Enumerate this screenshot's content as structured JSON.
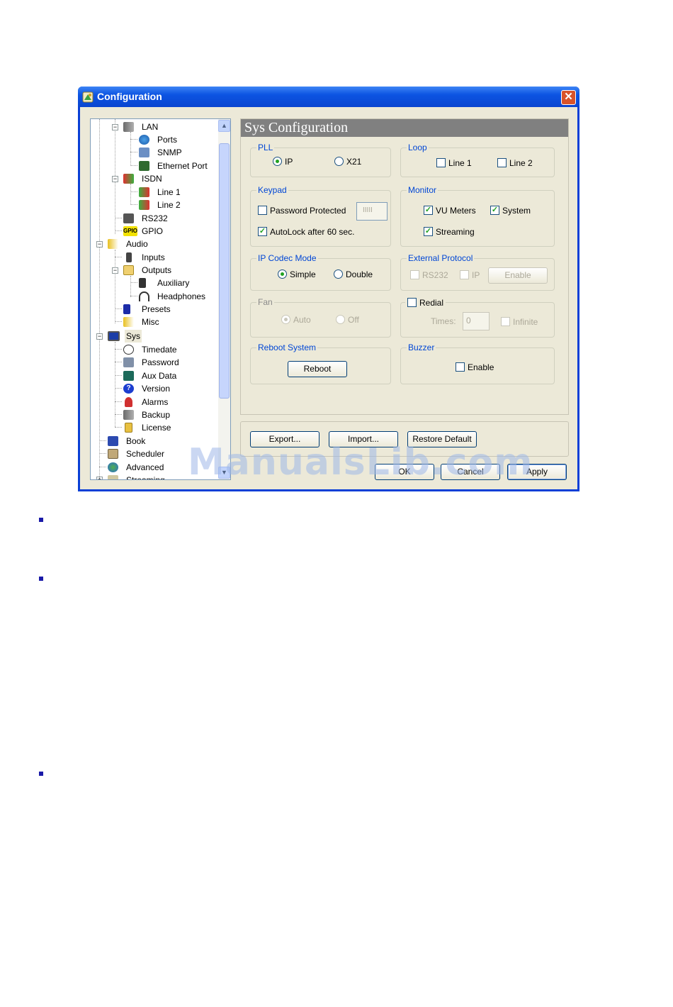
{
  "window": {
    "title": "Configuration",
    "close_label": "✕"
  },
  "tree": {
    "items": [
      {
        "label": "LAN"
      },
      {
        "label": "Ports"
      },
      {
        "label": "SNMP"
      },
      {
        "label": "Ethernet Port"
      },
      {
        "label": "ISDN"
      },
      {
        "label": "Line 1"
      },
      {
        "label": "Line 2"
      },
      {
        "label": "RS232"
      },
      {
        "label": "GPIO"
      },
      {
        "label": "Audio"
      },
      {
        "label": "Inputs"
      },
      {
        "label": "Outputs"
      },
      {
        "label": "Auxiliary"
      },
      {
        "label": "Headphones"
      },
      {
        "label": "Presets"
      },
      {
        "label": "Misc"
      },
      {
        "label": "Sys"
      },
      {
        "label": "Timedate"
      },
      {
        "label": "Password"
      },
      {
        "label": "Aux Data"
      },
      {
        "label": "Version"
      },
      {
        "label": "Alarms"
      },
      {
        "label": "Backup"
      },
      {
        "label": "License"
      },
      {
        "label": "Book"
      },
      {
        "label": "Scheduler"
      },
      {
        "label": "Advanced"
      },
      {
        "label": "Streaming"
      }
    ],
    "gpio_icon_text": "GPIO"
  },
  "panel": {
    "title": "Sys Configuration",
    "pll": {
      "title": "PLL",
      "options": [
        "IP",
        "X21"
      ],
      "selected": "IP"
    },
    "loop": {
      "title": "Loop",
      "line1": "Line 1",
      "line2": "Line 2"
    },
    "keypad": {
      "title": "Keypad",
      "password_protected": "Password Protected",
      "password_value": "IIIII",
      "autolock": "AutoLock after 60 sec."
    },
    "monitor": {
      "title": "Monitor",
      "vu_meters": "VU Meters",
      "system": "System",
      "streaming": "Streaming"
    },
    "ip_codec": {
      "title": "IP Codec Mode",
      "simple": "Simple",
      "double": "Double",
      "selected": "Simple"
    },
    "ext_protocol": {
      "title": "External Protocol",
      "rs232": "RS232",
      "ip": "IP",
      "enable_button": "Enable"
    },
    "fan": {
      "title": "Fan",
      "auto": "Auto",
      "off": "Off"
    },
    "redial": {
      "label": "Redial",
      "times_label": "Times:",
      "times_value": "0",
      "infinite": "Infinite"
    },
    "reboot": {
      "title": "Reboot System",
      "button": "Reboot"
    },
    "buzzer": {
      "title": "Buzzer",
      "enable": "Enable"
    }
  },
  "footer": {
    "export": "Export...",
    "import": "Import...",
    "restore": "Restore Default",
    "ok": "OK",
    "cancel": "Cancel",
    "apply": "Apply"
  },
  "watermark": "ManualsLib.com",
  "colors": {
    "titlebar": "#0c54e2",
    "group_title": "#0046d5",
    "dialog_bg": "#ece9d8",
    "checkmark": "#21a121"
  }
}
